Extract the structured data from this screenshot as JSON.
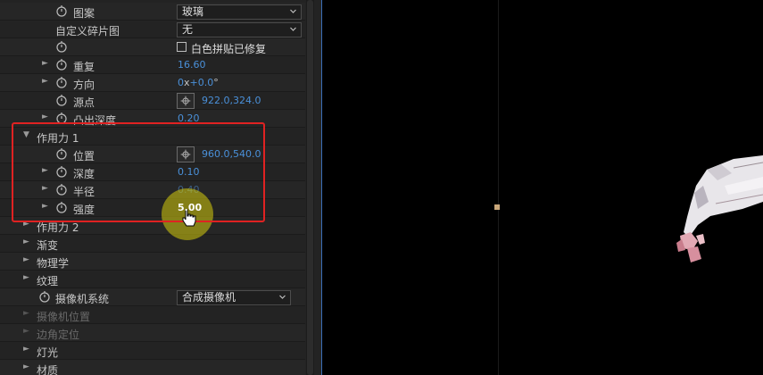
{
  "effects_panel": {
    "rows": [
      {
        "label": "图案",
        "dropdown": "玻璃"
      },
      {
        "label": "自定义碎片图",
        "dropdown": "无"
      },
      {
        "checkbox_label": "白色拼贴已修复"
      },
      {
        "label": "重复",
        "value": "16.60"
      },
      {
        "label": "方向",
        "value_prefix": "0",
        "value_x": "x",
        "value_suffix": "+0.0",
        "value_degree": "°"
      },
      {
        "label": "源点",
        "value": "922.0,324.0"
      },
      {
        "label": "凸出深度",
        "value": "0.20"
      },
      {
        "label": "作用力 1"
      },
      {
        "label": "位置",
        "value": "960.0,540.0"
      },
      {
        "label": "深度",
        "value": "0.10"
      },
      {
        "label": "半径",
        "value": "0.40"
      },
      {
        "label": "强度",
        "value": "5.00"
      },
      {
        "label": "作用力 2"
      },
      {
        "label": "渐变"
      },
      {
        "label": "物理学"
      },
      {
        "label": "纹理"
      },
      {
        "label": "摄像机系统",
        "dropdown": "合成摄像机"
      },
      {
        "label": "摄像机位置"
      },
      {
        "label": "边角定位"
      },
      {
        "label": "灯光"
      },
      {
        "label": "材质"
      }
    ]
  },
  "colors": {
    "panel_bg": "#232323",
    "value_blue": "#4a90d9",
    "highlight_red": "#e02222",
    "cursor_yellow": "#d6cc0c"
  },
  "icons": {
    "stopwatch": "stopwatch-icon",
    "expand": "triangle-right-icon",
    "collapse": "triangle-down-icon",
    "dropdown": "chevron-down-icon",
    "crosshair": "crosshair-icon",
    "cursor": "hand-pointer-icon"
  }
}
